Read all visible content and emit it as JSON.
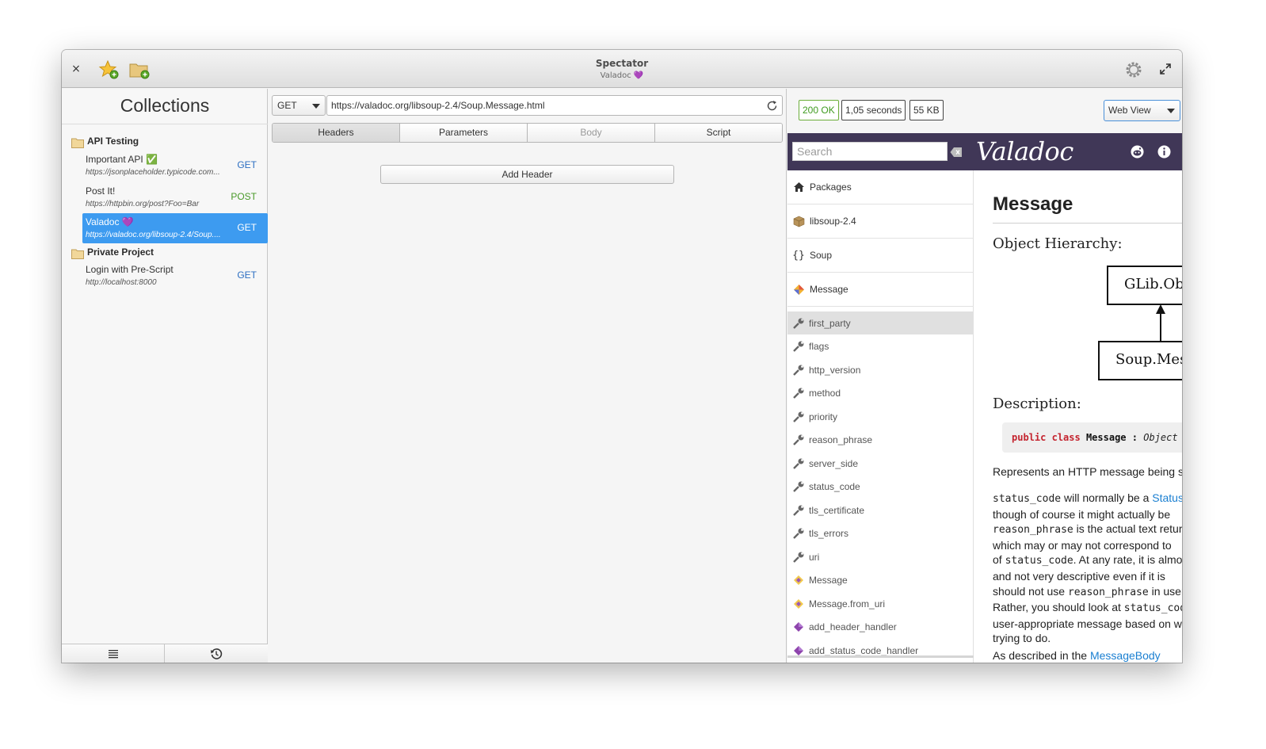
{
  "window": {
    "title": "Spectator",
    "subtitle": "Valadoc 💜",
    "close_glyph": "×"
  },
  "sidebar": {
    "title": "Collections",
    "folders": [
      {
        "name": "API Testing",
        "requests": [
          {
            "name": "Important API ✅",
            "url": "https://jsonplaceholder.typicode.com...",
            "method": "GET",
            "method_color": "#2d6fc2"
          },
          {
            "name": "Post It!",
            "url": "https://httpbin.org/post?Foo=Bar",
            "method": "POST",
            "method_color": "#4a9a2a"
          },
          {
            "name": "Valadoc 💜",
            "url": "https://valadoc.org/libsoup-2.4/Soup....",
            "method": "GET",
            "method_color": "#2d6fc2",
            "selected": true
          }
        ]
      },
      {
        "name": "Private Project",
        "requests": [
          {
            "name": "Login with Pre-Script",
            "url": "http://localhost:8000",
            "method": "GET",
            "method_color": "#2d6fc2"
          }
        ]
      }
    ],
    "bottom_icons": [
      "list-icon",
      "history-icon"
    ]
  },
  "request": {
    "method": "GET",
    "url": "https://valadoc.org/libsoup-2.4/Soup.Message.html",
    "tabs": [
      {
        "label": "Headers",
        "state": "active"
      },
      {
        "label": "Parameters",
        "state": "normal"
      },
      {
        "label": "Body",
        "state": "disabled"
      },
      {
        "label": "Script",
        "state": "normal"
      }
    ],
    "add_header_label": "Add Header"
  },
  "response": {
    "status": "200 OK",
    "time": "1,05 seconds",
    "size": "55 KB",
    "view_mode": "Web View",
    "status_color": "#3f9b1f"
  },
  "webview": {
    "search_placeholder": "Search",
    "logo": "Valadoc",
    "header_bg": "#403757",
    "nav_top": [
      {
        "label": "Packages",
        "icon": "home-icon"
      },
      {
        "label": "libsoup-2.4",
        "icon": "package-icon"
      },
      {
        "label": "Soup",
        "icon": "namespace-icon",
        "glyph": "{}"
      },
      {
        "label": "Message",
        "icon": "class-icon"
      }
    ],
    "nav_items": [
      {
        "label": "first_party",
        "icon": "property-icon",
        "highlighted": true
      },
      {
        "label": "flags",
        "icon": "property-icon"
      },
      {
        "label": "http_version",
        "icon": "property-icon"
      },
      {
        "label": "method",
        "icon": "property-icon"
      },
      {
        "label": "priority",
        "icon": "property-icon"
      },
      {
        "label": "reason_phrase",
        "icon": "property-icon"
      },
      {
        "label": "server_side",
        "icon": "property-icon"
      },
      {
        "label": "status_code",
        "icon": "property-icon"
      },
      {
        "label": "tls_certificate",
        "icon": "property-icon"
      },
      {
        "label": "tls_errors",
        "icon": "property-icon"
      },
      {
        "label": "uri",
        "icon": "property-icon"
      },
      {
        "label": "Message",
        "icon": "constructor-icon"
      },
      {
        "label": "Message.from_uri",
        "icon": "constructor-icon"
      },
      {
        "label": "add_header_handler",
        "icon": "method-icon"
      },
      {
        "label": "add_status_code_handler",
        "icon": "method-icon"
      }
    ],
    "content": {
      "heading": "Message",
      "hierarchy_title": "Object Hierarchy:",
      "box_parent": "GLib.Object",
      "box_child": "Soup.Message",
      "description_title": "Description:",
      "code": {
        "kw1": "public",
        "kw2": "class",
        "name": "Message",
        "sep": ":",
        "base": "Object"
      },
      "para1": "Represents an HTTP message being sent or received.",
      "para2": {
        "l1a": "status_code",
        "l1b": " will normally be a ",
        "l1link": "Status",
        "l2": "though of course it might actually be",
        "l3a": "reason_phrase",
        "l3b": " is the actual text returned",
        "l4": "which may or may not correspond to",
        "l5a": "of ",
        "l5b": "status_code",
        "l5c": ". At any rate, it is almost",
        "l6": "and not very descriptive even if it is",
        "l7a": "should not use ",
        "l7b": "reason_phrase",
        "l7c": " in user",
        "l8a": "Rather, you should look at ",
        "l8b": "status_code",
        "l9": "user-appropriate message based on what",
        "l10": "trying to do."
      },
      "para3a": "As described in the ",
      "para3link": "MessageBody"
    }
  }
}
